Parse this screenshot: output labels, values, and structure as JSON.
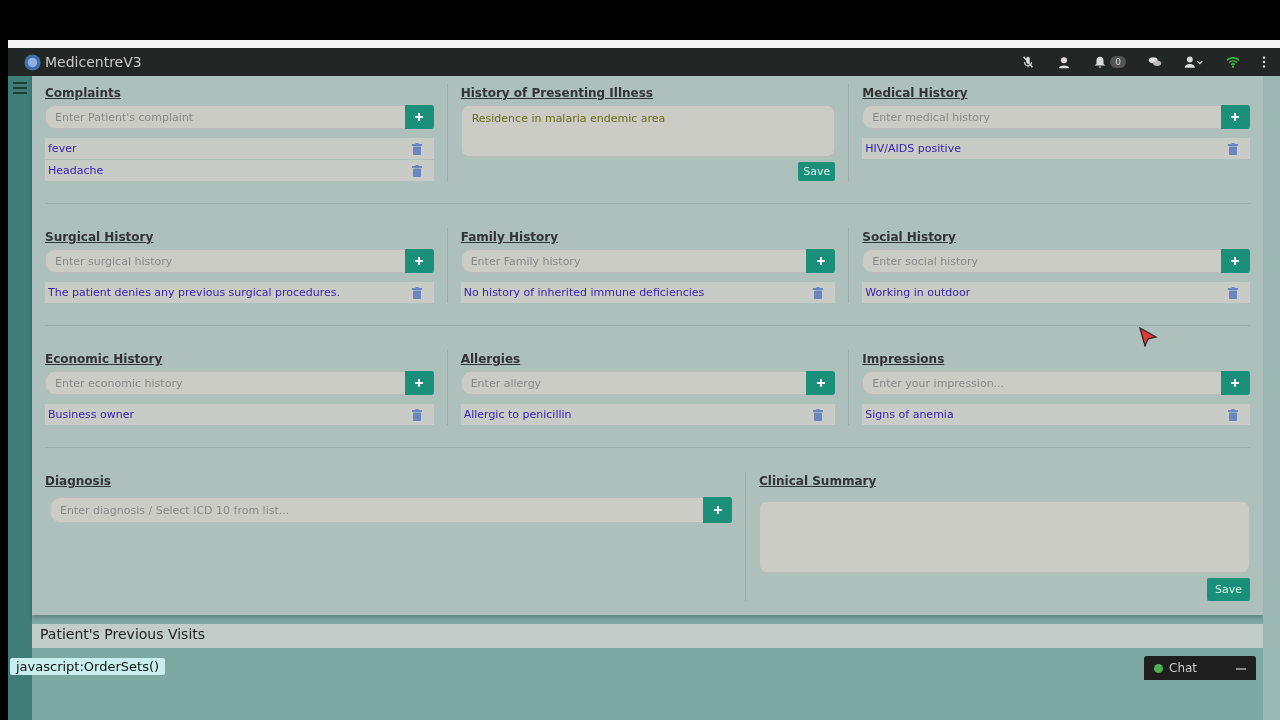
{
  "app": {
    "title": "MedicentreV3",
    "notification_count": "0"
  },
  "rows": [
    [
      {
        "kind": "list",
        "title": "Complaints",
        "placeholder": "Enter Patient's complaint",
        "items": [
          "fever",
          "Headache"
        ]
      },
      {
        "kind": "text",
        "title": "History of Presenting Illness",
        "value": "Residence in malaria endemic area",
        "button": "Save"
      },
      {
        "kind": "list",
        "title": "Medical History",
        "placeholder": "Enter medical history",
        "items": [
          "HIV/AIDS positive"
        ]
      }
    ],
    [
      {
        "kind": "list",
        "title": "Surgical History",
        "placeholder": "Enter surgical history",
        "items": [
          "The patient denies any previous surgical procedures."
        ]
      },
      {
        "kind": "list",
        "title": "Family History",
        "placeholder": "Enter Family history",
        "items": [
          "No history of inherited immune deficiencies"
        ]
      },
      {
        "kind": "list",
        "title": "Social History",
        "placeholder": "Enter social history",
        "items": [
          "Working in outdoor"
        ]
      }
    ],
    [
      {
        "kind": "list",
        "title": "Economic History",
        "placeholder": "Enter economic history",
        "items": [
          "Business owner"
        ]
      },
      {
        "kind": "list",
        "title": "Allergies",
        "placeholder": "Enter allergy",
        "items": [
          "Allergic to penicillin"
        ]
      },
      {
        "kind": "list",
        "title": "Impressions",
        "placeholder": "Enter your impression...",
        "items": [
          "Signs of anemia"
        ]
      }
    ]
  ],
  "diagnosis": {
    "title": "Diagnosis",
    "placeholder": "Enter diagnosis / Select ICD 10 from list..."
  },
  "clinical_summary": {
    "title": "Clinical Summary",
    "button": "Save"
  },
  "previous_visits": {
    "title": "Patient's Previous Visits"
  },
  "status_url": "javascript:OrderSets()",
  "chat": {
    "label": "Chat",
    "online": true
  }
}
